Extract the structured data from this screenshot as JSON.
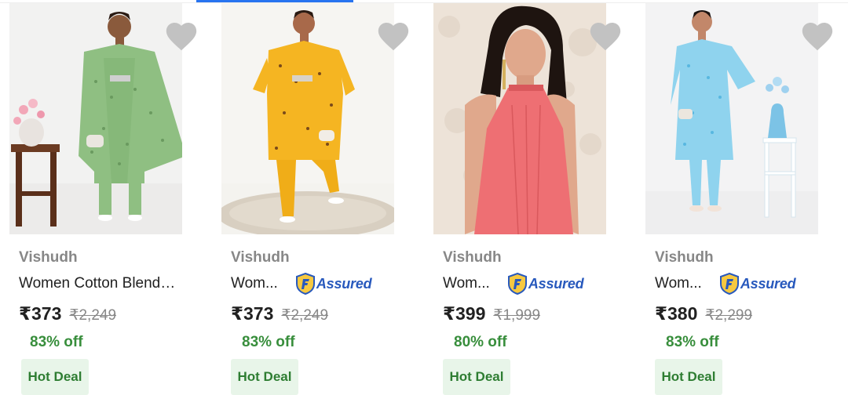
{
  "products": [
    {
      "brand": "Vishudh",
      "title": "Women Cotton Blend Printed Kaftan Kurta Set",
      "assured": false,
      "price": "₹373",
      "mrp": "₹2,249",
      "discount": "83% off",
      "deal": "Hot Deal",
      "image": {
        "bg": "#f2f2f1",
        "garment": "#8fbf82",
        "accent": "#6a9a5f",
        "prop": "stool-flowers"
      }
    },
    {
      "brand": "Vishudh",
      "title": "Women Printed Kaftan Kurta Set",
      "assured": true,
      "assured_label": "Assured",
      "price": "₹373",
      "mrp": "₹2,249",
      "discount": "83% off",
      "deal": "Hot Deal",
      "image": {
        "bg": "#f4f3ef",
        "garment": "#f5b522",
        "accent": "#d48a10",
        "prop": "rug"
      }
    },
    {
      "brand": "Vishudh",
      "title": "Women Halter Neck Top",
      "assured": true,
      "assured_label": "Assured",
      "price": "₹399",
      "mrp": "₹1,999",
      "discount": "80% off",
      "deal": "Hot Deal",
      "image": {
        "bg": "#ede3d8",
        "garment": "#ee6f73",
        "accent": "#d9585c",
        "prop": "portrait"
      }
    },
    {
      "brand": "Vishudh",
      "title": "Women Printed Kaftan Kurta Set",
      "assured": true,
      "assured_label": "Assured",
      "price": "₹380",
      "mrp": "₹2,299",
      "discount": "83% off",
      "deal": "Hot Deal",
      "image": {
        "bg": "#f3f3f4",
        "garment": "#8fd3ee",
        "accent": "#58b7e0",
        "prop": "shelf-vase"
      }
    }
  ],
  "colors": {
    "brand_text": "#878787",
    "price_text": "#212121",
    "discount_green": "#388e3c",
    "deal_bg": "#e8f5e9",
    "assured_blue": "#2859bd",
    "wishlist_gray": "#c2c2c2"
  },
  "icons": {
    "wishlist": "heart-icon",
    "assured": "f-assured-shield-icon"
  }
}
